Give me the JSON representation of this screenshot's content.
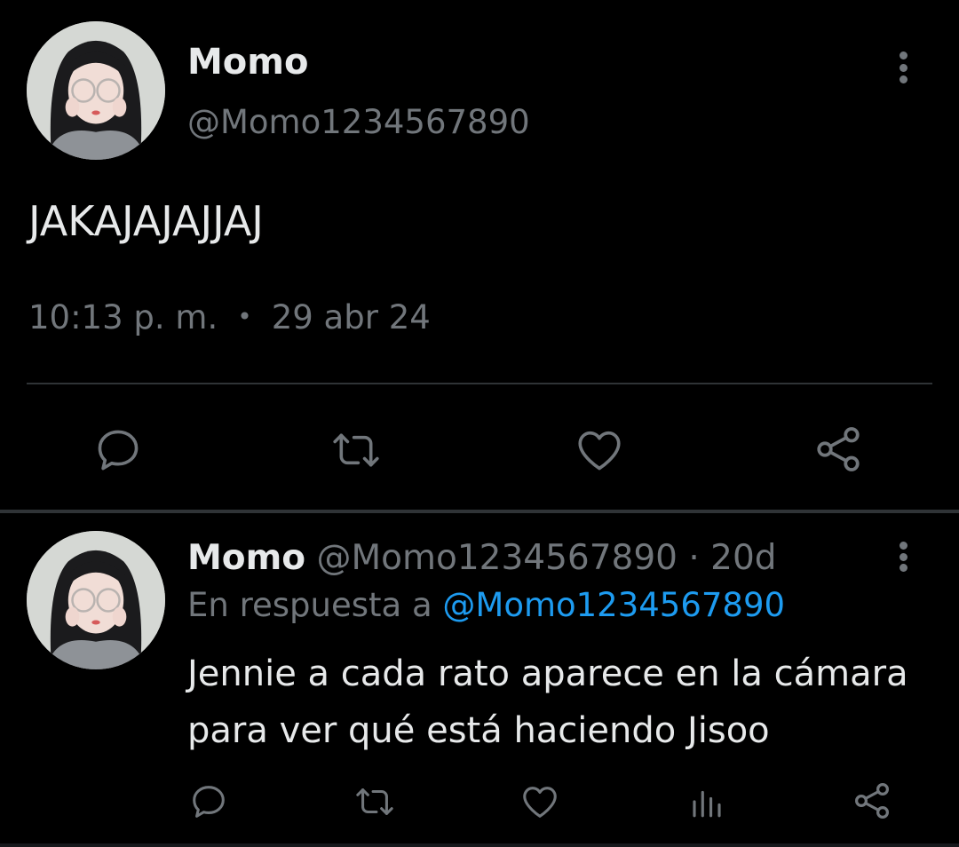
{
  "main_tweet": {
    "name": "Momo",
    "handle": "@Momo1234567890",
    "text": "JAKAJAJAJJAJ",
    "time": "10:13 p. m.",
    "separator": "•",
    "date": "29 abr 24",
    "actions": [
      "reply-icon",
      "retweet-icon",
      "like-icon",
      "share-icon"
    ]
  },
  "reply_tweet": {
    "name": "Momo",
    "handle": "@Momo1234567890",
    "age": "· 20d",
    "reply_prefix": "En respuesta a",
    "reply_mention": "@Momo1234567890",
    "text_line1": "Jennie a cada rato aparece en la cámara",
    "text_line2": "para ver qué está haciendo Jisoo",
    "actions": [
      "reply-icon",
      "retweet-icon",
      "like-icon",
      "views-icon",
      "share-icon"
    ]
  },
  "colors": {
    "background": "#000000",
    "primary_text": "#e7e9ea",
    "secondary_text": "#71767b",
    "link": "#1d9bf0",
    "divider": "#2f3336"
  }
}
